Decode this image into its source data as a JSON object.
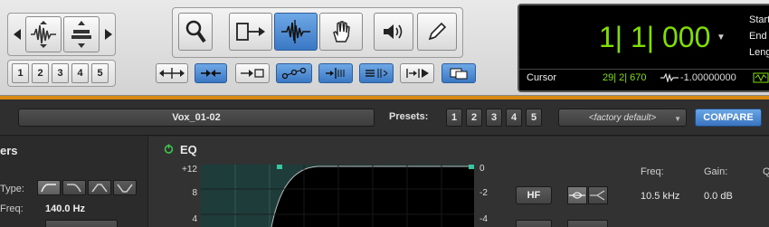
{
  "toolbar": {
    "zoom_presets": [
      "1",
      "2",
      "3",
      "4",
      "5"
    ],
    "icons": {
      "nudge_left": "triangle-left-icon",
      "nudge_right": "triangle-right-icon",
      "waveform": "waveform-zoom-icon",
      "lanes": "track-height-icon",
      "zoomer": "magnifier-icon",
      "trimmer": "trim-tool-icon",
      "selector": "selector-waveform-icon",
      "grabber": "hand-icon",
      "scrubber": "speaker-icon",
      "pencil": "pencil-icon"
    }
  },
  "counter": {
    "main": "1| 1| 000",
    "side_labels": [
      "Start",
      "End",
      "Length"
    ],
    "cursor_label": "Cursor",
    "cursor_position": "29| 2| 670",
    "cursor_value": "-1.00000000"
  },
  "plugin": {
    "track_name": "Vox_01-02",
    "presets_label": "Presets:",
    "preset_numbers": [
      "1",
      "2",
      "3",
      "4",
      "5"
    ],
    "preset_selected": "<factory default>",
    "compare_label": "COMPARE"
  },
  "panel": {
    "title": "ers",
    "type_label": "Type:",
    "freq_label": "Freq:",
    "freq_value": "140.0 Hz"
  },
  "eq": {
    "title": "EQ",
    "left_scale": [
      "+12",
      "8",
      "4"
    ],
    "right_scale": [
      "0",
      "-2",
      "-4"
    ],
    "band_label": "HF",
    "col_headers": [
      "Freq:",
      "Gain:",
      "Q"
    ],
    "col_values": [
      "10.5 kHz",
      "0.0 dB"
    ]
  },
  "colors": {
    "counter_green": "#7fe000",
    "accent_blue": "#3b78c4",
    "graph_bg": "#1e3d3a",
    "curve_marker": "#3bc5a0",
    "status_orange": "#d8890f"
  }
}
